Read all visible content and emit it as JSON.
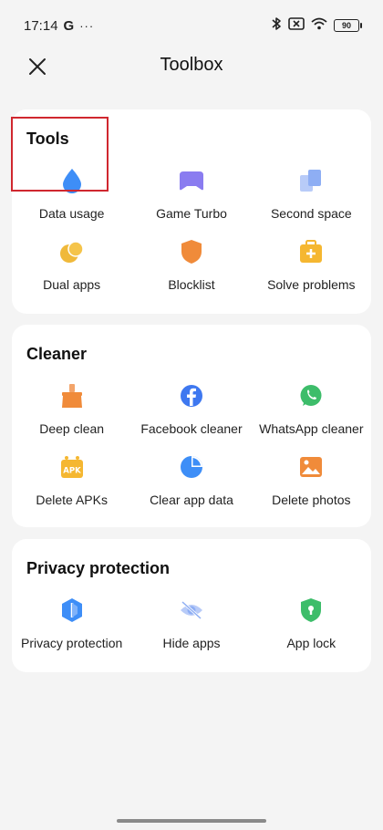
{
  "status": {
    "time": "17:14",
    "g": "G",
    "more": "···",
    "battery": "90"
  },
  "header": {
    "title": "Toolbox"
  },
  "tools": {
    "title": "Tools",
    "items": [
      {
        "label": "Data usage"
      },
      {
        "label": "Game Turbo"
      },
      {
        "label": "Second space"
      },
      {
        "label": "Dual apps"
      },
      {
        "label": "Blocklist"
      },
      {
        "label": "Solve problems"
      }
    ]
  },
  "cleaner": {
    "title": "Cleaner",
    "items": [
      {
        "label": "Deep clean"
      },
      {
        "label": "Facebook cleaner"
      },
      {
        "label": "WhatsApp cleaner"
      },
      {
        "label": "Delete APKs"
      },
      {
        "label": "Clear app data"
      },
      {
        "label": "Delete photos"
      }
    ]
  },
  "privacy": {
    "title": "Privacy protection",
    "items": [
      {
        "label": "Privacy protection"
      },
      {
        "label": "Hide apps"
      },
      {
        "label": "App lock"
      }
    ]
  },
  "colors": {
    "blue": "#3e8ef7",
    "purple": "#8a7cf0",
    "orange": "#f08b3a",
    "yellow": "#f5b731",
    "green": "#3dbd6a",
    "highlight": "#d0272f"
  }
}
